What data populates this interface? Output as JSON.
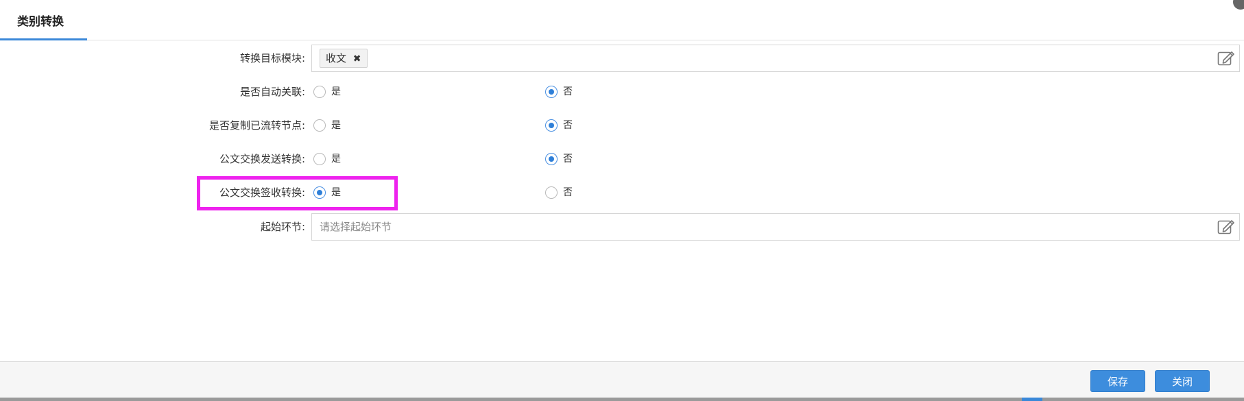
{
  "tab": {
    "title": "类别转换"
  },
  "form": {
    "target_module": {
      "label": "转换目标模块:",
      "tags": [
        "收文"
      ],
      "remove_glyph": "✖",
      "edit_icon": "edit-icon"
    },
    "auto_link": {
      "label": "是否自动关联:",
      "options": [
        "是",
        "否"
      ],
      "selected": "否"
    },
    "copy_nodes": {
      "label": "是否复制已流转节点:",
      "options": [
        "是",
        "否"
      ],
      "selected": "否"
    },
    "exchange_send": {
      "label": "公文交换发送转换:",
      "options": [
        "是",
        "否"
      ],
      "selected": "否"
    },
    "exchange_receive": {
      "label": "公文交换签收转换:",
      "options": [
        "是",
        "否"
      ],
      "selected": "是"
    },
    "start_step": {
      "label": "起始环节:",
      "placeholder": "请选择起始环节",
      "edit_icon": "edit-icon"
    }
  },
  "footer": {
    "save_label": "保存",
    "close_label": "关闭"
  },
  "colors": {
    "accent": "#3a88d8",
    "highlight": "#ee22ee",
    "button": "#3d8ddd"
  }
}
